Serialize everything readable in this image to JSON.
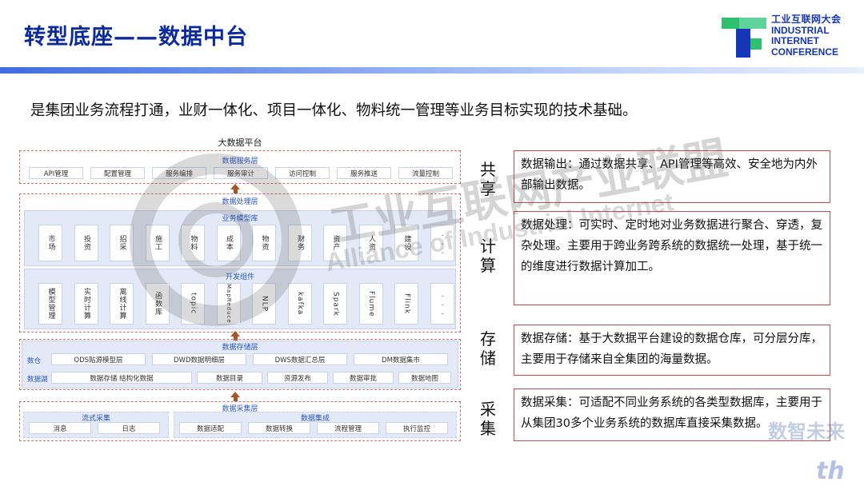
{
  "title": "转型底座——数据中台",
  "logo": {
    "cn": "工业互联网大会",
    "en1": "INDUSTRIAL",
    "en2": "INTERNET",
    "en3": "CONFERENCE"
  },
  "subtitle": "是集团业务流程打通，业财一体化、项目一体化、物料统一管理等业务目标实现的技术基础。",
  "diagram": {
    "platform_title": "大数据平台",
    "service_layer": {
      "title": "数据服务层",
      "items": [
        "API管理",
        "配置管理",
        "服务编排",
        "服务审计",
        "访问控制",
        "服务推送",
        "流量控制"
      ]
    },
    "process_layer": {
      "title": "数据处理层",
      "model_title": "业务模型库",
      "model_items": [
        "市场",
        "投资",
        "招采",
        "施工",
        "物料",
        "成本",
        "物资",
        "财务",
        "资产",
        "人资",
        "建设",
        "..."
      ],
      "dev_title": "开发组件",
      "dev_items": [
        "模型管理",
        "实时计算",
        "离线计算",
        "函数库",
        "topic",
        "MapReduce",
        "NLP",
        "kafka",
        "Spark",
        "Flume",
        "Flink",
        "..."
      ]
    },
    "storage_layer": {
      "title": "数据存储层",
      "row1_label": "数仓",
      "row1_items": [
        "ODS贴源模型层",
        "DWD数据明细层",
        "DWS数据汇总层",
        "DM数据集市"
      ],
      "row2_label": "数据湖",
      "row2_items": [
        "数据存储 结构化数据",
        "数据目录",
        "资源发布",
        "数据审批",
        "数据地图"
      ]
    },
    "collect_layer": {
      "title": "数据采集层",
      "stream_title": "流式采集",
      "stream_items": [
        "消息",
        "日志"
      ],
      "integ_title": "数据集成",
      "integ_items": [
        "数据适配",
        "数据转换",
        "流程管理",
        "执行监控"
      ]
    }
  },
  "sections": [
    {
      "label": "共享",
      "desc": "数据输出：通过数据共享、API管理等高效、安全地为内外部输出数据。"
    },
    {
      "label": "计算",
      "desc": "数据处理：可实时、定时地对业务数据进行聚合、穿透，复杂处理。主要用于跨业务跨系统的数据统一处理，基于统一的维度进行数据计算加工。"
    },
    {
      "label": "存储",
      "desc": "数据存储：基于大数据平台建设的数据仓库，可分层分库，主要用于存储来自全集团的海量数据。"
    },
    {
      "label": "采集",
      "desc": "数据采集：可适配不同业务系统的各类型数据库，主要用于从集团30多个业务系统的数据库直接采集数据。"
    }
  ],
  "watermark": {
    "line1": "工业互联网产业联盟",
    "line2": "Alliance of Industrial Internet",
    "corner1": "数智未来",
    "corner2": "th"
  },
  "colors": {
    "title": "#0b2a9c",
    "accent": "#1636b8",
    "border_red": "#c94a4a",
    "logo_green": "#2fbf71",
    "logo_blue": "#1636b8"
  }
}
